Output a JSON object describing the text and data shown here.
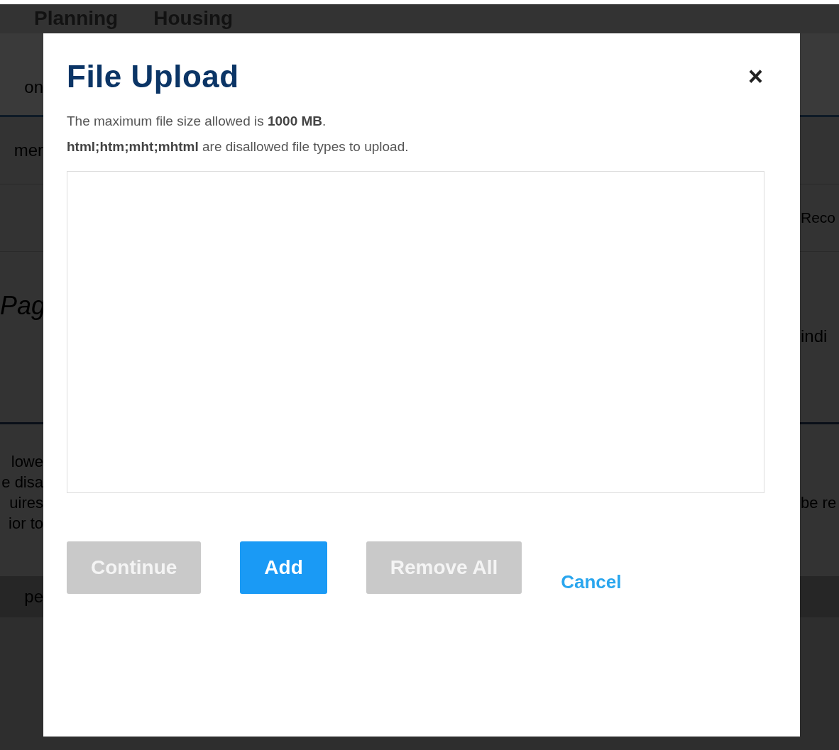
{
  "background": {
    "nav": [
      {
        "label": "Planning"
      },
      {
        "label": "Housing"
      }
    ],
    "rows": [
      {
        "left": "on",
        "right": "",
        "kind": "band"
      },
      {
        "left": "mer",
        "right": "",
        "kind": "plain"
      },
      {
        "left": "",
        "right": "Reco",
        "kind": "plain"
      },
      {
        "left": "Pag",
        "right": "indi",
        "kind": "heading"
      },
      {
        "left": "lowe\ne disa\nuires\nior to",
        "right": "be re",
        "kind": "notes"
      },
      {
        "left": "pe",
        "right": "",
        "kind": "header"
      }
    ]
  },
  "dialog": {
    "title": "File Upload",
    "close": "×",
    "messages": [
      "The maximum file size allowed is **1000 MB**.",
      "**html;htm;mht;mhtml** are disallowed file types to upload."
    ],
    "buttons": [
      {
        "label": "Continue",
        "disabled": true,
        "kind": "button"
      },
      {
        "label": "Add",
        "disabled": false,
        "kind": "button"
      },
      {
        "label": "Remove All",
        "disabled": true,
        "kind": "button"
      },
      {
        "label": "Cancel",
        "disabled": false,
        "kind": "link"
      }
    ]
  }
}
